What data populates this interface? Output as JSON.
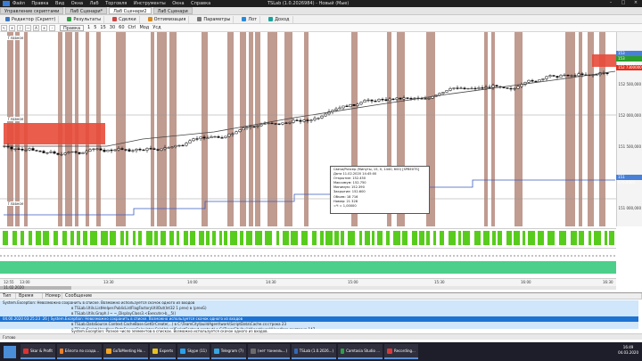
{
  "titlebar": {
    "menu": [
      "Файл",
      "Правка",
      "Вид",
      "Окна",
      "Лаб",
      "Торговля",
      "Инструменты",
      "Окна",
      "Справка"
    ],
    "title": "TSLab (1.0.2026984) - Новый ⟨Мые⟩"
  },
  "doctabs": [
    "Управление скриптами",
    "Лаб Сценари*",
    "Лаб Сценари2",
    "Лаб Сценари"
  ],
  "toolbar1": {
    "editor": "Редактор (Скрипт)",
    "results": "Результаты",
    "deals": "Сделки",
    "optim": "Оптимизация",
    "params": "Параметры",
    "lev": "Лот",
    "income": "Доход"
  },
  "toolbar2": {
    "mode": "Правка",
    "tf": [
      "1",
      "5",
      "15",
      "30",
      "60"
    ],
    "links": [
      "Ctrl",
      "Мод",
      "Усд"
    ]
  },
  "chart": {
    "pane_labels": [
      "Главное",
      "Главное",
      "Главное"
    ],
    "price_labels": [
      "153 000,000",
      "152 500,000",
      "152 000,000",
      "151 500,000",
      "151 000,000"
    ],
    "price_tags": [
      {
        "text": "153 450,0000",
        "color": "#4a7fd8"
      },
      {
        "text": "153 450,0000",
        "color": "#2a9d2a"
      },
      {
        "text": "152 7300000",
        "color": "#e03020"
      },
      {
        "text": "151 676,0000",
        "color": "#4a7fd8"
      }
    ],
    "colors": {
      "band": "#b58a7c",
      "candle_up": "#ffffff",
      "candle_down": "#000000",
      "ma": "#444444",
      "lower": "#3a5cc0",
      "green": "#58cc1c",
      "red": "#e84a38"
    }
  },
  "tooltip": {
    "lines": [
      "Свеча/Ризсер (Минуты, 15, 0, 1440, 600) [SPBEXTS]",
      "Дата 11.02.2020 14:45:00",
      "Открытие: 152.450",
      "Максимум: 152.750",
      "Минимум: 152.390",
      "Закрытие: 152.600",
      "Объем: 18 716",
      "Номер: 21 328",
      "=Ч = 1,00000"
    ]
  },
  "timeaxis": {
    "labels": [
      "12:55",
      "13:00",
      "13:30",
      "14:00",
      "14:30",
      "15:00",
      "15:30",
      "16:00",
      "16:30"
    ],
    "date": "11.02.2020"
  },
  "log": {
    "columns": [
      "Тип",
      "Время",
      "Номер",
      "Сообщение"
    ],
    "rows": [
      "System.Exception: Невозможно сохранить в списке. Возможно используется скачок одного из входов",
      "в TSLab.Utils.ListHelper.PublicListFlagFactoryUtilOut(Int32 1 prev) в (prexG)",
      "в TSLab.Utils.Graph.I ~ ~_DisplayClass3.<Execute>b__5()",
      "в TSLab.DataSource.Context.CacheBase.GetOrCreate(...) в C:\\TeamCity\\buildAgent\\work\\ScriptData\\Cache.cs:строка 23",
      "в TSLab.Script.Handlers.DataSourceCalculator.CalcValue(IScriptContext context) в C:\\TeamCity\\buildAgent\\work\\Handlers.cs:строка 147",
      "04.00.2020 03:25:23 :26 | System.Exception: Невозможно сохранить в списке. Возможно используется скачок одного из входов",
      "System.Exception: Разное число элементов в списках. Возможно используется скачок одного из входов."
    ]
  },
  "statusbar": "Готово",
  "taskbar": {
    "items": [
      "Skar & Profit",
      "Еёлота по созда...",
      "GoToMeeting Ho...",
      "Experts",
      "Skype (11)",
      "Telegram (7)",
      "(нет тоннель...)",
      "TSLab (1.0.2026...)",
      "Camtasia Studio ...",
      "Recording..."
    ],
    "time": "16:49",
    "date": "04.03.2020"
  }
}
